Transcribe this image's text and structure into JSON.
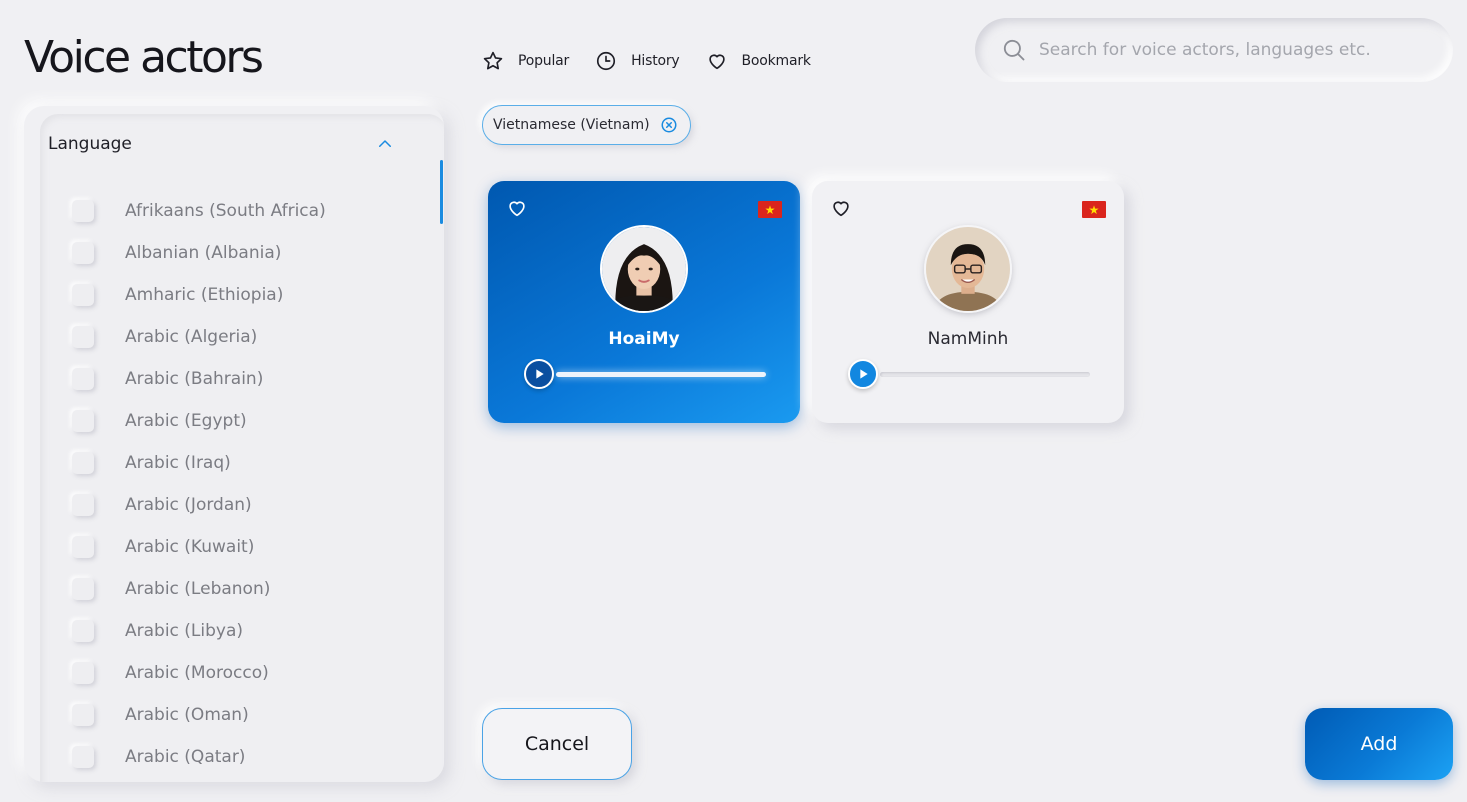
{
  "header": {
    "title": "Voice actors",
    "tabs": [
      {
        "label": "Popular",
        "icon": "star-icon"
      },
      {
        "label": "History",
        "icon": "clock-icon"
      },
      {
        "label": "Bookmark",
        "icon": "heart-icon"
      }
    ],
    "search": {
      "placeholder": "Search for voice actors, languages etc.",
      "value": ""
    }
  },
  "sidebar": {
    "section_title": "Language",
    "languages": [
      "Afrikaans (South Africa)",
      "Albanian (Albania)",
      "Amharic (Ethiopia)",
      "Arabic (Algeria)",
      "Arabic (Bahrain)",
      "Arabic (Egypt)",
      "Arabic (Iraq)",
      "Arabic (Jordan)",
      "Arabic (Kuwait)",
      "Arabic (Lebanon)",
      "Arabic (Libya)",
      "Arabic (Morocco)",
      "Arabic (Oman)",
      "Arabic (Qatar)"
    ]
  },
  "filters": {
    "active": [
      {
        "label": "Vietnamese (Vietnam)"
      }
    ]
  },
  "actors": [
    {
      "name": "HoaiMy",
      "selected": true,
      "flag": "vietnam-flag"
    },
    {
      "name": "NamMinh",
      "selected": false,
      "flag": "vietnam-flag"
    }
  ],
  "footer": {
    "cancel_label": "Cancel",
    "add_label": "Add"
  },
  "colors": {
    "accent": "#0a78d8",
    "background": "#f0f0f3",
    "flag_red": "#da251d",
    "flag_star": "#ffde00"
  }
}
